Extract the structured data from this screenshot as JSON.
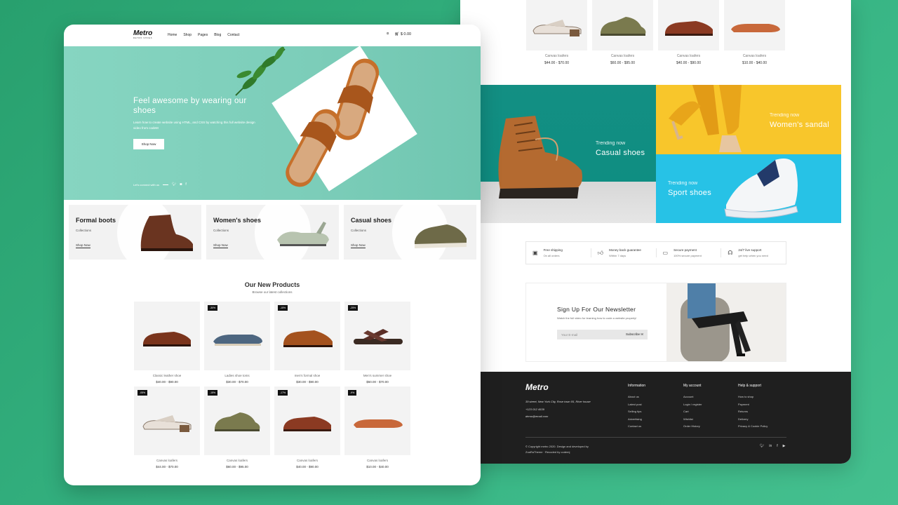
{
  "colors": {
    "background": "#2fa877",
    "hero_teal": "#7ccdb9",
    "casual_teal": "#0f8e82",
    "sandal_yellow": "#f8c62b",
    "sport_blue": "#27c2e6",
    "footer_dark": "#1f1f1f"
  },
  "header": {
    "logo": "Metro",
    "logo_sub": "METRO SHOES",
    "nav": [
      "Home",
      "Shop",
      "Pages",
      "Blog",
      "Contact"
    ],
    "cart": "$ 0.00"
  },
  "hero": {
    "title": "Feel awesome by wearing our shoes",
    "subtitle": "Learn how to create website using HTML, and CSS by watching this full website design video from codeM",
    "button": "Shop Now",
    "connect": "Let's connect with us"
  },
  "categories": [
    {
      "title": "Formal boots",
      "sub": "Collections",
      "link": "Shop Now"
    },
    {
      "title": "Women's shoes",
      "sub": "Collections",
      "link": "Shop Now"
    },
    {
      "title": "Casual shoes",
      "sub": "Collections",
      "link": "Shop Now"
    }
  ],
  "new_products": {
    "title": "Our New Products",
    "subtitle": "Browse our latest collections",
    "items": [
      {
        "badge": "",
        "name": "Classic leather shoe",
        "price": "$40.00 - $90.00"
      },
      {
        "badge": "-30%",
        "name": "Ladies shoe toms",
        "price": "$30.00 - $70.00"
      },
      {
        "badge": "-15%",
        "name": "men's formal shoe",
        "price": "$30.00 - $90.00"
      },
      {
        "badge": "-25%",
        "name": "Men's summer shoe",
        "price": "$50.00 - $70.00"
      },
      {
        "badge": "-05%",
        "name": "Canvas loafers",
        "price": "$44.00 - $70.00"
      },
      {
        "badge": "-15%",
        "name": "Canvas loafers",
        "price": "$60.00 - $95.00"
      },
      {
        "badge": "-17%",
        "name": "Canvas loafers",
        "price": "$40.00 - $90.00"
      },
      {
        "badge": "-9%",
        "name": "Canvas loafers",
        "price": "$10.00 - $40.00"
      }
    ]
  },
  "top_products": [
    {
      "name": "Canvas loafers",
      "price": "$44.00 - $70.00"
    },
    {
      "name": "Canvas loafers",
      "price": "$60.00 - $95.00"
    },
    {
      "name": "Canvas loafers",
      "price": "$40.00 - $90.00"
    },
    {
      "name": "Canvas loafers",
      "price": "$10.00 - $40.00"
    }
  ],
  "trending": {
    "casual": {
      "small": "Trending now",
      "big": "Casual shoes"
    },
    "women": {
      "small": "Trending now",
      "big": "Women's sandal"
    },
    "sport": {
      "small": "Trending now",
      "big": "Sport shoes"
    }
  },
  "features": [
    {
      "icon": "box-icon",
      "title": "Free shipping",
      "sub": "On all orders"
    },
    {
      "icon": "thumbs-up-icon",
      "title": "Money back guarantee",
      "sub": "Within 7 days"
    },
    {
      "icon": "card-icon",
      "title": "Secure payment",
      "sub": "100% secure payment"
    },
    {
      "icon": "headset-icon",
      "title": "24/7 live support",
      "sub": "get help when you need"
    }
  ],
  "newsletter": {
    "title": "Sign Up For Our Newsletter",
    "subtitle": "Watch the full video for learning how to code a website properly!",
    "placeholder": "Your E-mail",
    "button": "Subscribe"
  },
  "footer": {
    "logo": "Metro",
    "address": "39 street, New York City, Rose town 05, River house",
    "phone": "+123 012 4539",
    "email": "demo@email.com",
    "columns": [
      {
        "heading": "Information",
        "items": [
          "About us",
          "Latest post",
          "Selling tips",
          "Advertising",
          "Contact us"
        ]
      },
      {
        "heading": "My account",
        "items": [
          "Account",
          "Login / register",
          "Cart",
          "Wishlist",
          "Order History"
        ]
      },
      {
        "heading": "Help & support",
        "items": [
          "How to shop",
          "Payment",
          "Returns",
          "Delivery",
          "Privacy & Cookie Policy"
        ]
      }
    ],
    "copyright_1": "© Copyright metro 2020. Design and developed by",
    "copyright_2": "ZoaRaTheme · Recoded by codemj"
  }
}
